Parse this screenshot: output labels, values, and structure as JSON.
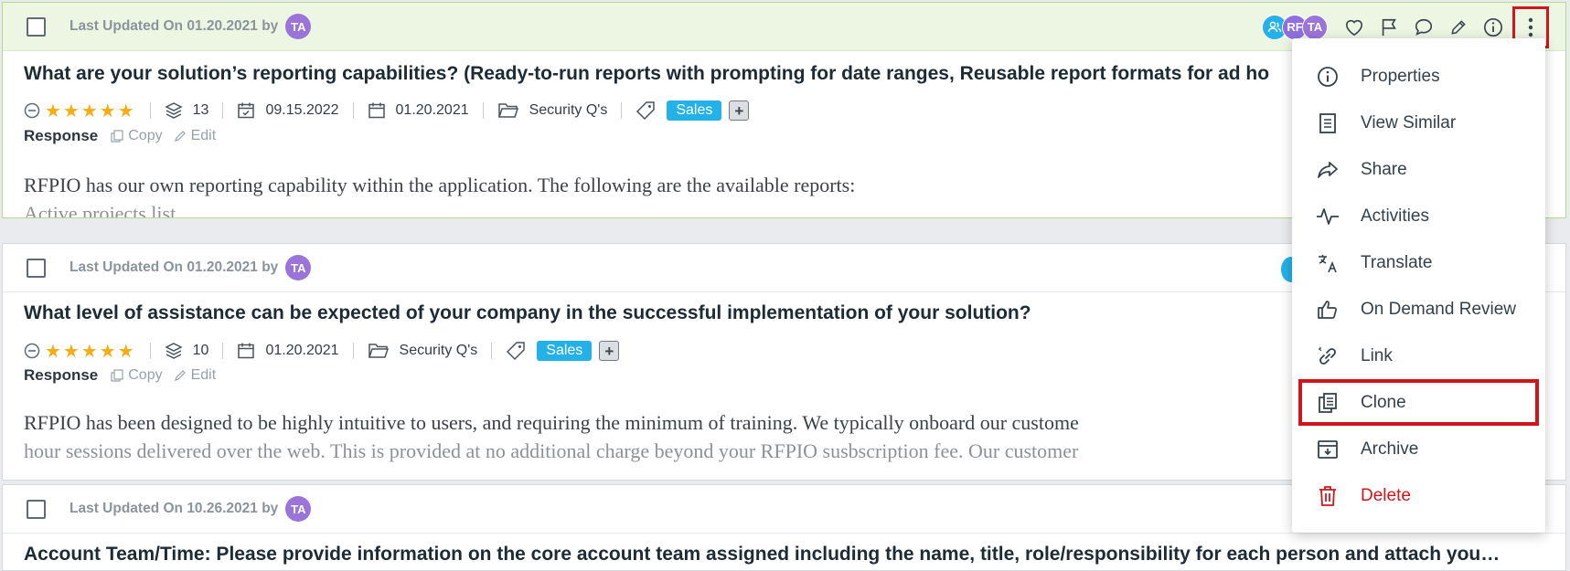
{
  "cards": [
    {
      "updated_label": "Last Updated On 01.20.2021 by",
      "avatar": "TA",
      "question": "What are your solution’s reporting capabilities? (Ready-to-run reports with prompting for date ranges, Reusable report formats for ad ho",
      "rating_stars": "★★★★★",
      "count": "13",
      "date_due": "09.15.2022",
      "date_updated": "01.20.2021",
      "folder": "Security Q's",
      "tag": "Sales",
      "response_label": "Response",
      "copy_label": "Copy",
      "edit_label": "Edit",
      "body_line1": "RFPIO has our own reporting capability within the application. The following are the available reports:",
      "body_line2": "Active projects list"
    },
    {
      "updated_label": "Last Updated On 01.20.2021 by",
      "avatar": "TA",
      "question": "What level of assistance can be expected of your company in the successful implementation of your solution?",
      "rating_stars": "★★★★★",
      "count": "10",
      "date_updated": "01.20.2021",
      "folder": "Security Q's",
      "tag": "Sales",
      "response_label": "Response",
      "copy_label": "Copy",
      "edit_label": "Edit",
      "body_line1": "RFPIO has been designed to be highly intuitive to users, and requiring the minimum of training. We typically onboard our custome",
      "body_line2": "hour sessions delivered over the web. This is provided at no additional charge beyond your RFPIO susbscription fee. Our customer"
    },
    {
      "updated_label": "Last Updated On 10.26.2021 by",
      "avatar": "TA",
      "question": "Account Team/Time: Please provide information on the core account team assigned including the name, title, role/responsibility for each person and attach you…"
    }
  ],
  "toolbar": {
    "avatars": [
      "RF",
      "TA"
    ],
    "icons": [
      "user-group-icon",
      "heart-icon",
      "flag-icon",
      "comment-icon",
      "pencil-icon",
      "info-icon",
      "kebab-menu-icon"
    ]
  },
  "menu": {
    "items": [
      {
        "label": "Properties",
        "icon": "info-icon"
      },
      {
        "label": "View Similar",
        "icon": "document-icon"
      },
      {
        "label": "Share",
        "icon": "share-icon"
      },
      {
        "label": "Activities",
        "icon": "activity-icon"
      },
      {
        "label": "Translate",
        "icon": "translate-icon"
      },
      {
        "label": "On Demand Review",
        "icon": "thumbs-up-icon"
      },
      {
        "label": "Link",
        "icon": "link-icon"
      },
      {
        "label": "Clone",
        "icon": "clone-icon"
      },
      {
        "label": "Archive",
        "icon": "archive-icon"
      },
      {
        "label": "Delete",
        "icon": "trash-icon"
      }
    ]
  },
  "colors": {
    "accent_blue": "#23b1e8",
    "avatar_purple": "#9b74d9",
    "star": "#f5ad12",
    "highlight_red": "#d0161c",
    "selected_bg": "#edf6e3"
  }
}
